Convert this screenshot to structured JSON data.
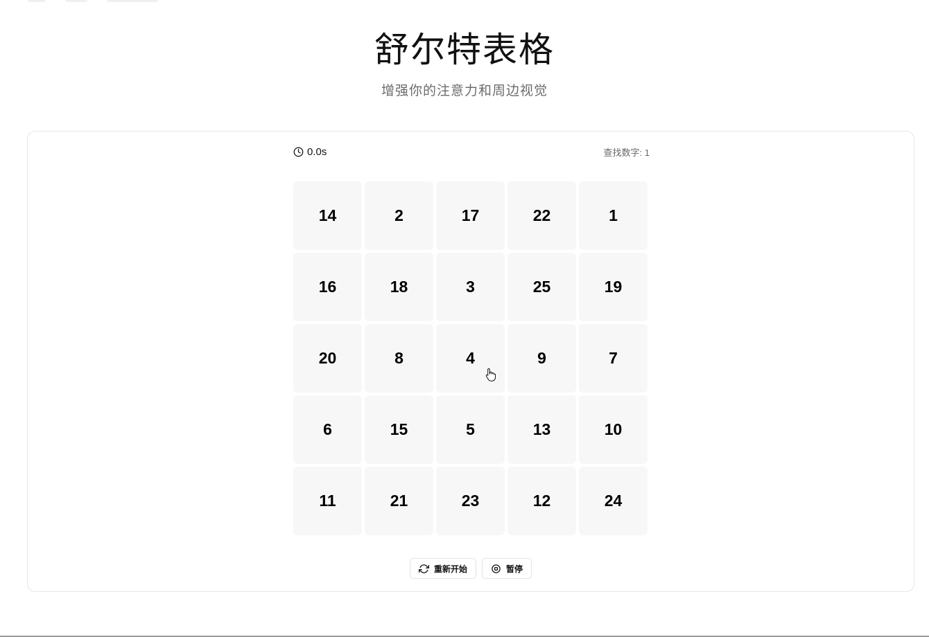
{
  "header": {
    "title": "舒尔特表格",
    "subtitle": "增强你的注意力和周边视觉"
  },
  "stats": {
    "timer_icon": "clock-icon",
    "timer": "0.0s",
    "target_label": "查找数字: 1"
  },
  "grid": {
    "cells": [
      "14",
      "2",
      "17",
      "22",
      "1",
      "16",
      "18",
      "3",
      "25",
      "19",
      "20",
      "8",
      "4",
      "9",
      "7",
      "6",
      "15",
      "5",
      "13",
      "10",
      "11",
      "21",
      "23",
      "12",
      "24"
    ]
  },
  "controls": {
    "restart_icon": "refresh-icon",
    "restart_label": "重新开始",
    "pause_icon": "pause-circle-icon",
    "pause_label": "暂停"
  },
  "colors": {
    "cell_background": "#f7f7f7",
    "card_border": "#e6e6e6",
    "text_primary": "#111111",
    "text_muted": "#666666"
  }
}
